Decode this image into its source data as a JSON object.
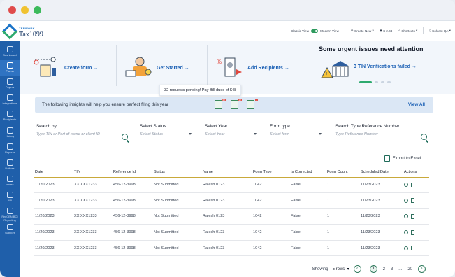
{
  "header": {
    "logo_top": "ZENWORK",
    "logo_main": "Tax1099",
    "classic_view": "Classic View",
    "modern_view": "Modern View",
    "create_new": "Create New",
    "credits": "$ 2.04",
    "shortcuts": "Shortcuts",
    "user": "Solvent QA"
  },
  "sidebar": {
    "items": [
      {
        "label": "Dashboard",
        "icon": "dashboard-icon"
      },
      {
        "label": "Forms",
        "icon": "forms-icon"
      },
      {
        "label": "Payers",
        "icon": "payers-icon"
      },
      {
        "label": "Integrations",
        "icon": "integrations-icon"
      },
      {
        "label": "Recipients",
        "icon": "recipients-icon"
      },
      {
        "label": "History",
        "icon": "history-icon"
      },
      {
        "label": "Reports",
        "icon": "reports-icon"
      },
      {
        "label": "Notices",
        "icon": "notices-icon"
      },
      {
        "label": "Issues",
        "icon": "issues-icon"
      },
      {
        "label": "API",
        "icon": "api-icon"
      },
      {
        "label": "Fin-CEN BOI Reporting",
        "icon": "fincen-icon"
      },
      {
        "label": "Support",
        "icon": "support-icon"
      }
    ],
    "active_index": 1
  },
  "hero": {
    "create_form": "Create form →",
    "get_started": "Get Started →",
    "add_recipients": "Add Recipients →",
    "urgent_title": "Some urgent issues need attention",
    "tin_link": "3 TIN Verifications failed →"
  },
  "tooltip": "32 requests pending! Pay Bill dues of $48",
  "insights": {
    "text": "The following insights will help you ensure perfect filing this year",
    "badges": [
      "52",
      "12",
      "7"
    ],
    "view_all": "View All"
  },
  "filters": {
    "search_by": {
      "label": "Search by",
      "placeholder": "Type TIN or Part of name or client ID"
    },
    "status": {
      "label": "Select Status",
      "placeholder": "Select Status"
    },
    "year": {
      "label": "Select Year",
      "placeholder": "Select Year"
    },
    "form_type": {
      "label": "Form type",
      "placeholder": "Select form"
    },
    "ref_number": {
      "label": "Search Type Reference Number",
      "placeholder": "Type Reference Number"
    }
  },
  "export_label": "Export to Excel",
  "table": {
    "columns": [
      "Date",
      "TIN",
      "Reference Id",
      "Status",
      "Name",
      "Form Type",
      "Is Corrected",
      "Form Count",
      "Scheduled Date",
      "Actions"
    ],
    "rows": [
      [
        "11/20/2023",
        "XX XXX1233",
        "456-12-3998",
        "Not Submitted",
        "Rajesh 0123",
        "1042",
        "False",
        "1",
        "11/23/2023"
      ],
      [
        "11/20/2023",
        "XX XXX1233",
        "456-12-3998",
        "Not Submitted",
        "Rajesh 0123",
        "1042",
        "False",
        "1",
        "11/23/2023"
      ],
      [
        "11/20/2023",
        "XX XXX1233",
        "456-12-3998",
        "Not Submitted",
        "Rajesh 0123",
        "1042",
        "False",
        "1",
        "11/23/2023"
      ],
      [
        "11/20/2023",
        "XX XXX1233",
        "456-12-3998",
        "Not Submitted",
        "Rajesh 0123",
        "1042",
        "False",
        "1",
        "11/23/2023"
      ],
      [
        "11/20/2023",
        "XX XXX1233",
        "456-12-3998",
        "Not Submitted",
        "Rajesh 0123",
        "1042",
        "False",
        "1",
        "11/23/2023"
      ]
    ]
  },
  "pagination": {
    "showing": "Showing",
    "rows": "5 rows",
    "pages": [
      "1",
      "2",
      "3",
      "...",
      "20"
    ]
  },
  "colors": {
    "sidebar": "#1f5faa",
    "accent_link": "#1a5fb4",
    "accent_green": "#2eaa6e",
    "traffic_red": "#e04b4b",
    "traffic_yellow": "#f0c230",
    "traffic_green": "#3cba5b"
  }
}
